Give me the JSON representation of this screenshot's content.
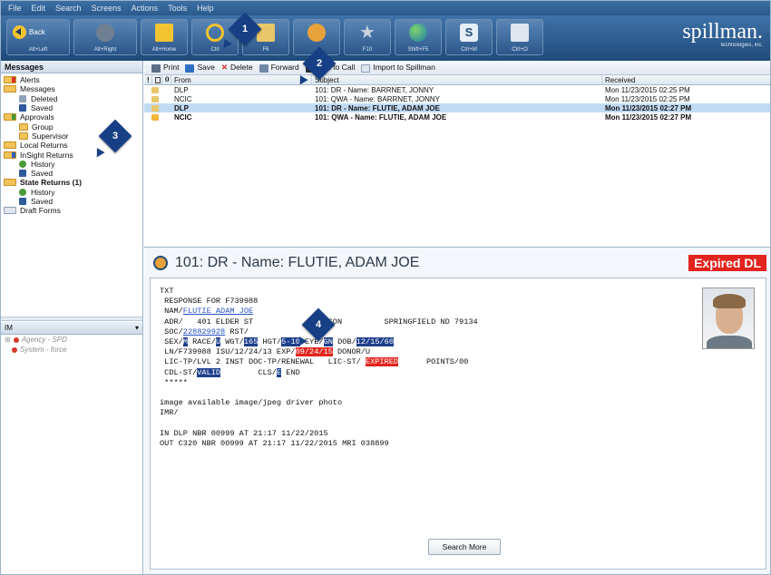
{
  "menu": [
    "File",
    "Edit",
    "Search",
    "Screens",
    "Actions",
    "Tools",
    "Help"
  ],
  "toolbar": {
    "buttons": [
      {
        "icon": "back-arrow-icon",
        "label": "Back",
        "hint": "Alt+Left"
      },
      {
        "icon": "forward-arrow-icon",
        "label": "",
        "hint": "Alt+Right"
      },
      {
        "icon": "home-icon",
        "label": "",
        "hint": "Alt+Home"
      },
      {
        "icon": "search-icon",
        "label": "",
        "hint": "Ctrl"
      },
      {
        "icon": "mail-icon",
        "label": "",
        "hint": "F6"
      },
      {
        "icon": "person-search-icon",
        "label": "",
        "hint": ""
      },
      {
        "icon": "star-icon",
        "label": "",
        "hint": "F10"
      },
      {
        "icon": "globe-icon",
        "label": "",
        "hint": "Shift+F5"
      },
      {
        "icon": "s-icon",
        "label": "",
        "hint": "Ctrl+M"
      },
      {
        "icon": "form-icon",
        "label": "",
        "hint": "Ctrl+O"
      }
    ],
    "logo": "spillman.",
    "logo_sub": "technologies, inc."
  },
  "messages_panel": {
    "title": "Messages",
    "items": [
      {
        "label": "Alerts",
        "level": 0,
        "bold": false
      },
      {
        "label": "Messages",
        "level": 0,
        "bold": false
      },
      {
        "label": "Deleted",
        "level": 1,
        "bold": false
      },
      {
        "label": "Saved",
        "level": 1,
        "bold": false
      },
      {
        "label": "Approvals",
        "level": 0,
        "bold": false
      },
      {
        "label": "Group",
        "level": 1,
        "bold": false
      },
      {
        "label": "Supervisor",
        "level": 1,
        "bold": false
      },
      {
        "label": "Local Returns",
        "level": 0,
        "bold": false
      },
      {
        "label": "InSight Returns",
        "level": 0,
        "bold": false
      },
      {
        "label": "History",
        "level": 1,
        "bold": false
      },
      {
        "label": "Saved",
        "level": 1,
        "bold": false
      },
      {
        "label": "State Returns (1)",
        "level": 0,
        "bold": true
      },
      {
        "label": "History",
        "level": 1,
        "bold": false
      },
      {
        "label": "Saved",
        "level": 1,
        "bold": false
      },
      {
        "label": "Draft Forms",
        "level": 0,
        "bold": false
      }
    ]
  },
  "im_panel": {
    "title": "IM",
    "agency": "Agency - SPD",
    "system": "System - force"
  },
  "actions": {
    "print": "Print",
    "save": "Save",
    "delete": "Delete",
    "forward": "Forward",
    "add_to_call": "Add to Call",
    "import": "Import to Spillman"
  },
  "grid": {
    "headers": [
      "!",
      "",
      "From",
      "Subject",
      "Received"
    ],
    "rows": [
      {
        "from": "DLP",
        "subject": "101: DR - Name: BARRNET, JONNY",
        "received": "Mon 11/23/2015 02:25 PM",
        "selected": false,
        "bold": false
      },
      {
        "from": "NCIC",
        "subject": "101: QWA - Name: BARRNET, JONNY",
        "received": "Mon 11/23/2015 02:25 PM",
        "selected": false,
        "bold": false
      },
      {
        "from": "DLP",
        "subject": "101: DR - Name: FLUTIE, ADAM JOE",
        "received": "Mon 11/23/2015 02:27 PM",
        "selected": true,
        "bold": true
      },
      {
        "from": "NCIC",
        "subject": "101: QWA - Name: FLUTIE, ADAM JOE",
        "received": "Mon 11/23/2015 02:27 PM",
        "selected": false,
        "bold": true
      }
    ]
  },
  "detail": {
    "title": "101: DR - Name: FLUTIE, ADAM JOE",
    "badge": "Expired DL",
    "lines": {
      "l1": "TXT",
      "l2": " RESPONSE FOR F739988",
      "nam_prefix": " NAM/",
      "nam_link": "FLUTIE ADAM JOE",
      "l4": " ADR/   401 ELDER ST             RANSON         SPRINGFIELD ND 79134",
      "soc_prefix": " SOC/",
      "soc_link": "228829928",
      "soc_suffix": " RST/",
      "sex_prefix": " SEX/",
      "sex": "M",
      "race_prefix": " RACE/",
      "race": "U",
      "wgt_prefix": " WGT/",
      "wgt": "165",
      "hgt_prefix": " HGT/",
      "hgt": "5-10",
      "eye_prefix": " EYE/",
      "eye": "GN",
      "dob_prefix": " DOB/",
      "dob": "12/15/60",
      "ln_prefix": " LN/F739988 ISU/12/24/13 EXP/",
      "exp": "09/24/15",
      "ln_suffix": " DONOR/U",
      "lic_prefix": " LIC-TP/LVL 2 INST DOC-TP/RENEWAL   LIC-ST/ ",
      "lic_st": "EXPIRED",
      "lic_suffix": "      POINTS/00",
      "cdl_prefix": " CDL-ST/",
      "cdl": "VALID",
      "cls_prefix": "        CLS/",
      "cls": "E",
      "cls_suffix": " END",
      "l10": " *****",
      "l11": "",
      "l12": "image available image/jpeg driver photo",
      "l13": "IMR/",
      "l14": "",
      "l15": "IN DLP NBR 00999 AT 21:17 11/22/2015",
      "l16": "OUT C320 NBR 00999 AT 21:17 11/22/2015 MRI 038899"
    },
    "search_more": "Search More"
  },
  "callouts": [
    "1",
    "2",
    "3",
    "4"
  ],
  "colors": {
    "accent": "#173f85",
    "alert_red": "#e3231d",
    "selection": "#c2dbf5",
    "toolbar_blue": "#2a568a"
  }
}
